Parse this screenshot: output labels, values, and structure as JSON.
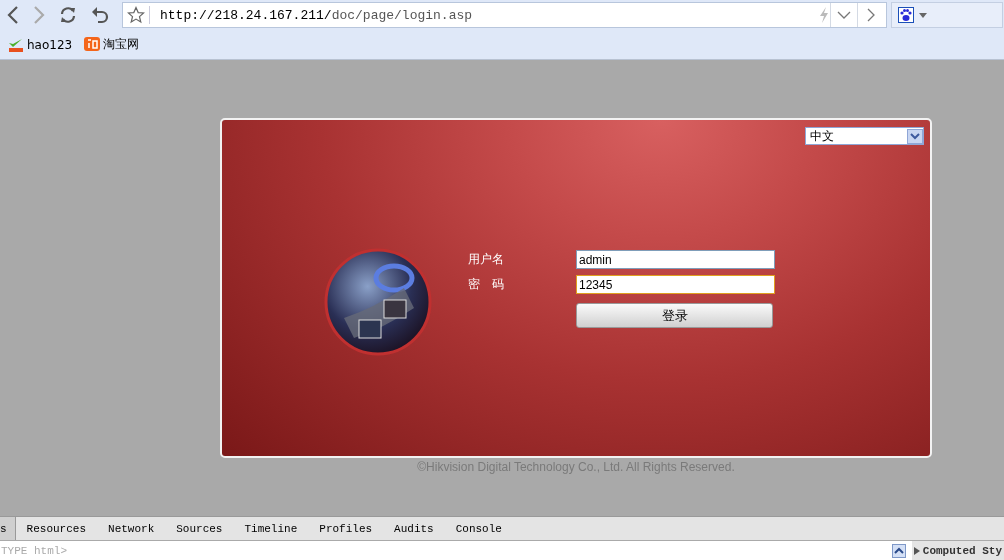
{
  "browser": {
    "url_host": "http://218.24.167.211/",
    "url_path": "doc/page/login.asp",
    "bookmarks": [
      {
        "label": "hao123"
      },
      {
        "label": "淘宝网"
      }
    ]
  },
  "login": {
    "language": "中文",
    "fields": [
      {
        "label": "用户名",
        "value": "admin",
        "focused": false
      },
      {
        "label": "密　码",
        "value": "12345",
        "focused": true
      }
    ],
    "submit": "登录",
    "copyright": "©Hikvision Digital Technology Co., Ltd. All Rights Reserved."
  },
  "devtools": {
    "tabs": [
      {
        "label": "s",
        "selected": true
      },
      {
        "label": "Resources",
        "selected": false
      },
      {
        "label": "Network",
        "selected": false
      },
      {
        "label": "Sources",
        "selected": false
      },
      {
        "label": "Timeline",
        "selected": false
      },
      {
        "label": "Profiles",
        "selected": false
      },
      {
        "label": "Audits",
        "selected": false
      },
      {
        "label": "Console",
        "selected": false
      }
    ],
    "console_text": "TYPE html>",
    "computed_label": "Computed Sty"
  }
}
